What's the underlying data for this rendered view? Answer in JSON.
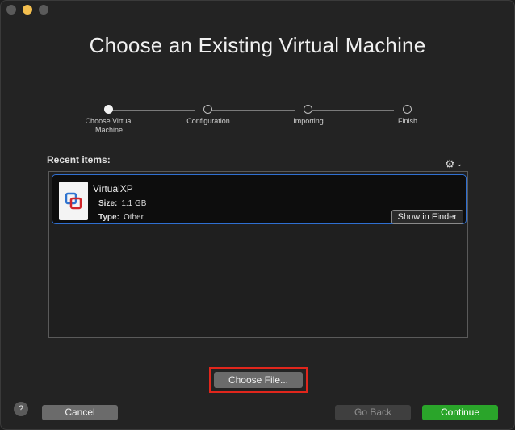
{
  "window": {
    "title": "Choose an Existing Virtual Machine"
  },
  "steps": [
    {
      "label": "Choose Virtual Machine",
      "active": true
    },
    {
      "label": "Configuration",
      "active": false
    },
    {
      "label": "Importing",
      "active": false
    },
    {
      "label": "Finish",
      "active": false
    }
  ],
  "recent": {
    "label": "Recent items:",
    "items": [
      {
        "name": "VirtualXP",
        "size_label": "Size:",
        "size_value": "1.1 GB",
        "type_label": "Type:",
        "type_value": "Other",
        "show_in_finder_label": "Show in Finder"
      }
    ]
  },
  "actions": {
    "choose_file_label": "Choose File...",
    "help_label": "?",
    "cancel_label": "Cancel",
    "go_back_label": "Go Back",
    "continue_label": "Continue"
  },
  "icons": {
    "settings": "gear-icon",
    "vm": "vmware-icon"
  },
  "colors": {
    "accent_green": "#2aa52a",
    "selection_blue": "#2f6fd1",
    "highlight_red": "#e1261c"
  }
}
